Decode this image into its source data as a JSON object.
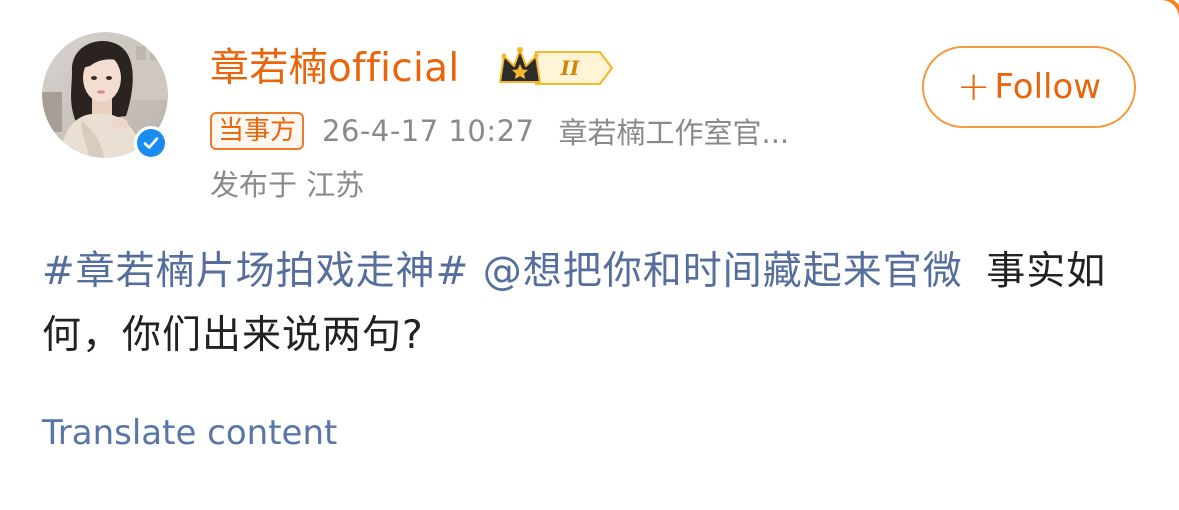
{
  "post": {
    "author": {
      "name": "章若楠official",
      "level_badge": "II"
    },
    "follow_label": "Follow",
    "follow_plus": "+",
    "party_tag": "当事方",
    "timestamp": "26-4-17 10:27",
    "source": "章若楠工作室官...",
    "location": "发布于 江苏",
    "content": {
      "hashtag": "#章若楠片场拍戏走神#",
      "mention": "@想把你和时间藏起来官微",
      "text": "事实如何，你们出来说两句?"
    },
    "translate_label": "Translate content"
  },
  "colors": {
    "brand_orange": "#e8650c",
    "follow_border": "#f29a3c",
    "link_blue": "#556e9d",
    "verified_blue": "#1a8cf0",
    "meta_gray": "#8a8a8a",
    "crown_gold": "#f5b82e"
  },
  "icons": {
    "avatar": "profile-photo",
    "verified": "verified-check-icon",
    "crown": "crown-member-icon",
    "follow": "plus-icon"
  }
}
